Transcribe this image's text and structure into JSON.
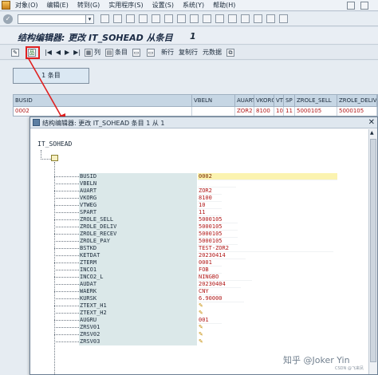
{
  "menu": {
    "items": [
      "对象(O)",
      "编辑(E)",
      "转到(G)",
      "实用程序(S)",
      "设置(S)",
      "系统(Y)",
      "帮助(H)"
    ]
  },
  "title": {
    "text": "结构编辑器: 更改 IT_SOHEAD 从条目",
    "count": "1"
  },
  "app_toolbar": {
    "column_label": "列",
    "entry_label": "条目",
    "new_row_label": "新行",
    "copy_row_label": "复制行",
    "metadata_label": "元数据"
  },
  "entries_box": "1 条目",
  "grid": {
    "headers": [
      "BUSID",
      "VBELN",
      "AUART",
      "VKORG",
      "VT",
      "SP",
      "ZROLE_SELL",
      "ZROLE_DELIV"
    ],
    "row": [
      "0002",
      "",
      "ZOR2",
      "8100",
      "10",
      "11",
      "5000105",
      "5000105"
    ]
  },
  "dialog": {
    "title": "结构编辑器: 更改 IT_SOHEAD 条目 1 从 1",
    "root": "IT_SOHEAD",
    "fields": [
      {
        "name": "BUSID",
        "value": "0002",
        "selected": true
      },
      {
        "name": "VBELN",
        "value": ""
      },
      {
        "name": "AUART",
        "value": "ZOR2"
      },
      {
        "name": "VKORG",
        "value": "8100"
      },
      {
        "name": "VTWEG",
        "value": "10"
      },
      {
        "name": "SPART",
        "value": "11"
      },
      {
        "name": "ZROLE_SELL",
        "value": "5000105"
      },
      {
        "name": "ZROLE_DELIV",
        "value": "5000105"
      },
      {
        "name": "ZROLE_RECEV",
        "value": "5000105"
      },
      {
        "name": "ZROLE_PAY",
        "value": "5000105"
      },
      {
        "name": "BSTKD",
        "value": "TEST-ZOR2"
      },
      {
        "name": "KETDAT",
        "value": "20230414"
      },
      {
        "name": "ZTERM",
        "value": "0001"
      },
      {
        "name": "INCO1",
        "value": "FOB"
      },
      {
        "name": "INCO2_L",
        "value": "NINGBO"
      },
      {
        "name": "AUDAT",
        "value": "20230404"
      },
      {
        "name": "WAERK",
        "value": "CNY"
      },
      {
        "name": "KURSK",
        "value": "6.90000"
      },
      {
        "name": "ZTEXT_H1",
        "value": "",
        "icon": true
      },
      {
        "name": "ZTEXT_H2",
        "value": "",
        "icon": true
      },
      {
        "name": "AUGRU",
        "value": "001"
      },
      {
        "name": "ZRSV01",
        "value": "",
        "icon": true
      },
      {
        "name": "ZRSV02",
        "value": "",
        "icon": true
      },
      {
        "name": "ZRSV03",
        "value": "",
        "icon": true
      }
    ]
  },
  "watermark": "知乎 @Joker Yin",
  "watermark_sub": "CSDN @飞来凤",
  "colors": {
    "value_red": "#b01818",
    "highlight_red": "#e02020",
    "label_bg": "#dbe8e9",
    "selected_bg": "#fbf3b0"
  }
}
